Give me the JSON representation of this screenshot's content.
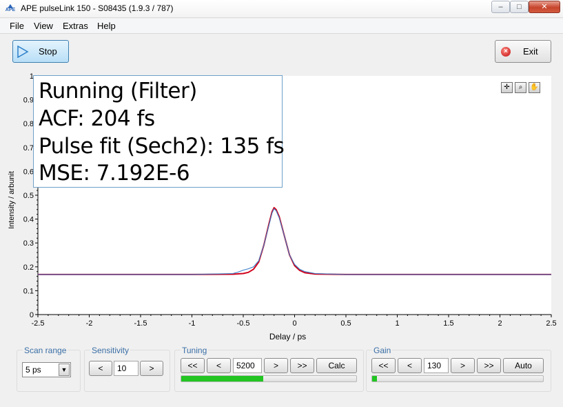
{
  "window": {
    "title": "APE pulseLink 150 - S08435 (1.9.3 / 787)",
    "icon_text": "APE",
    "controls": {
      "minimize": "–",
      "maximize": "□",
      "close": "✕"
    }
  },
  "menu": {
    "items": [
      "File",
      "View",
      "Extras",
      "Help"
    ]
  },
  "toolbar": {
    "stop_label": "Stop",
    "exit_label": "Exit"
  },
  "info": {
    "lines": [
      "Running (Filter)",
      "ACF: 204 fs",
      "Pulse fit (Sech2): 135 fs",
      "MSE: 7.192E-6"
    ]
  },
  "plot_tools": [
    "cursor-tool-icon",
    "zoom-tool-icon",
    "pan-hand-icon"
  ],
  "chart_data": {
    "type": "line",
    "xlabel": "Delay / ps",
    "ylabel": "Intensity / arbunit",
    "xlim": [
      -2.5,
      2.5
    ],
    "ylim": [
      0,
      1
    ],
    "x_ticks": [
      -2.5,
      -2,
      -1.5,
      -1,
      -0.5,
      0,
      0.5,
      1,
      1.5,
      2,
      2.5
    ],
    "x_tick_labels": [
      "-2.5",
      "-2",
      "-1.5",
      "-1",
      "-0.5",
      "0",
      "0.5",
      "1",
      "1.5",
      "2",
      "2.5"
    ],
    "y_ticks": [
      0,
      0.1,
      0.2,
      0.3,
      0.4,
      0.5,
      0.6,
      0.7,
      0.8,
      0.9,
      1
    ],
    "y_tick_labels": [
      "0",
      "0.1",
      "0.2",
      "0.3",
      "0.4",
      "0.5",
      "0.6",
      "0.7",
      "0.8",
      "0.9",
      "1"
    ],
    "grid": false,
    "series": [
      {
        "color": "#d0021b",
        "x": [
          -2.5,
          -1.0,
          -0.6,
          -0.5,
          -0.45,
          -0.4,
          -0.35,
          -0.3,
          -0.25,
          -0.22,
          -0.2,
          -0.18,
          -0.15,
          -0.1,
          -0.05,
          0.0,
          0.05,
          0.1,
          0.2,
          0.5,
          2.5
        ],
        "y": [
          0.168,
          0.168,
          0.169,
          0.172,
          0.177,
          0.19,
          0.22,
          0.29,
          0.38,
          0.43,
          0.448,
          0.44,
          0.41,
          0.33,
          0.25,
          0.205,
          0.185,
          0.175,
          0.17,
          0.168,
          0.168
        ]
      },
      {
        "color": "#3a7dc8",
        "x": [
          -2.5,
          -1.0,
          -0.6,
          -0.55,
          -0.5,
          -0.45,
          -0.4,
          -0.35,
          -0.3,
          -0.25,
          -0.22,
          -0.2,
          -0.18,
          -0.15,
          -0.1,
          -0.05,
          0.0,
          0.05,
          0.1,
          0.2,
          0.5,
          2.5
        ],
        "y": [
          0.168,
          0.168,
          0.172,
          0.178,
          0.186,
          0.192,
          0.2,
          0.225,
          0.29,
          0.375,
          0.425,
          0.443,
          0.435,
          0.405,
          0.33,
          0.25,
          0.21,
          0.19,
          0.18,
          0.172,
          0.168,
          0.168
        ]
      }
    ]
  },
  "controls": {
    "scan_range": {
      "title": "Scan range",
      "value": "5 ps"
    },
    "sensitivity": {
      "title": "Sensitivity",
      "dec": "<",
      "value": "10",
      "inc": ">"
    },
    "tuning": {
      "title": "Tuning",
      "fast_dec": "<<",
      "dec": "<",
      "value": "5200",
      "inc": ">",
      "fast_inc": ">>",
      "action": "Calc",
      "progress": 0.47,
      "progress_color": "#22c522"
    },
    "gain": {
      "title": "Gain",
      "fast_dec": "<<",
      "dec": "<",
      "value": "130",
      "inc": ">",
      "fast_inc": ">>",
      "action": "Auto",
      "progress": 0.03,
      "progress_color": "#22c522"
    }
  }
}
